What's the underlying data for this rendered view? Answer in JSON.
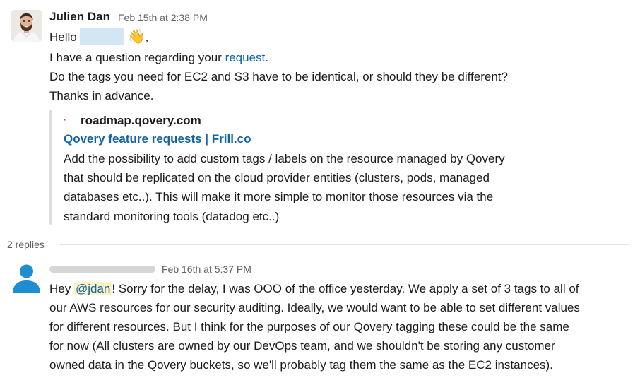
{
  "message1": {
    "author": "Julien Dan",
    "timestamp": "Feb 15th at 2:38 PM",
    "greeting": "Hello",
    "greeting_emoji": "👋",
    "greeting_comma": ",",
    "line2_prefix": "I have a question regarding your ",
    "line2_link": "request",
    "line2_suffix": ".",
    "line3": "Do the tags you need for EC2 and S3 have to be identical, or should they be different?",
    "line4": "Thanks in advance.",
    "unfurl": {
      "site": "roadmap.qovery.com",
      "title": "Qovery feature requests | Frill.co",
      "desc_lines": [
        "Add the possibility to add custom tags / labels on the resource managed by Qovery",
        "that should be replicated on the cloud provider entities (clusters, pods, managed",
        "databases etc..). This will make it more simple to monitor those resources via the",
        "standard monitoring tools (datadog etc..)"
      ]
    }
  },
  "thread": {
    "replies_label": "2 replies"
  },
  "message2": {
    "timestamp": "Feb 16th at 5:37 PM",
    "line1_prefix": "Hey ",
    "mention": "@jdan",
    "line1_suffix": "!  Sorry for the delay, I was OOO of the office yesterday.  We apply a set of 3 tags to all of",
    "lines": [
      "our AWS resources for our security auditing.  Ideally, we would want to be able to set different values",
      "for different resources.  But I think for the purposes of our Qovery tagging these could be the same",
      "for now  (All clusters are owned by our DevOps team, and we shouldn't be storing any customer",
      "owned data in the Qovery buckets, so we'll probably tag them the same as the EC2 instances)."
    ]
  }
}
